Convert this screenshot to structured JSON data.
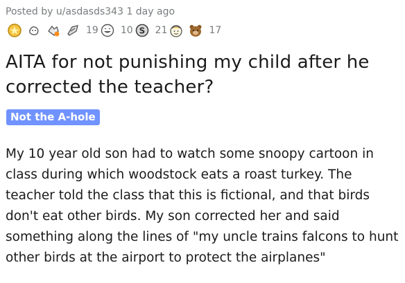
{
  "post": {
    "meta": "Posted by u/asdasds343 1 day ago",
    "title": "AITA for not punishing my child after he corrected the teacher?",
    "flair": "Not the A-hole",
    "flair_color": "#7193ff",
    "body": "My 10 year old son had to watch some snoopy cartoon in class during which woodstock eats a roast turkey. The teacher told the class that this is fictional, and that birds don't eat other birds. My son corrected her and said something along the lines of \"my uncle trains falcons to hunt other birds at the airport to protect the airplanes\""
  },
  "awards": [
    {
      "icon": "gold-award-icon",
      "count": ""
    },
    {
      "icon": "wholesome-award-icon",
      "count": ""
    },
    {
      "icon": "helpful-award-icon",
      "count": ""
    },
    {
      "icon": "rocket-like-award-icon",
      "count": "19"
    },
    {
      "icon": "laughing-award-icon",
      "count": "10"
    },
    {
      "icon": "silver-award-icon",
      "count": "21"
    },
    {
      "icon": "face-award-icon",
      "count": ""
    },
    {
      "icon": "bear-award-icon",
      "count": "17"
    }
  ]
}
